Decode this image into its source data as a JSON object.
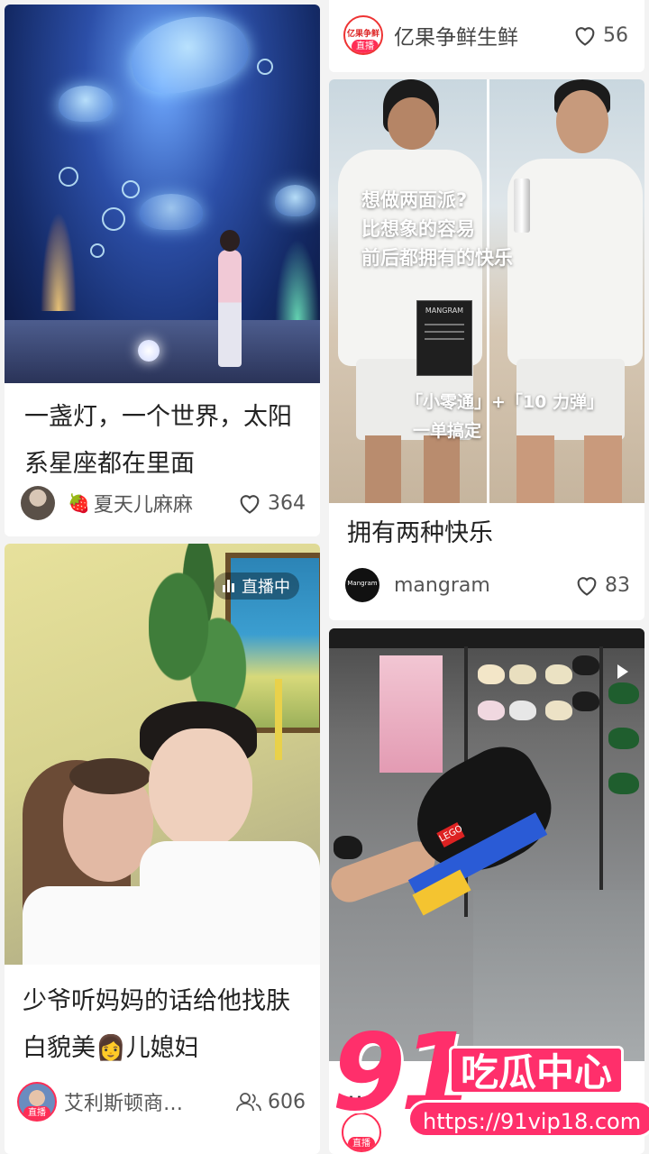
{
  "feed": {
    "cards": [
      {
        "title": "一盏灯，一个世界，太阳系星座都在里面",
        "author": "夏天儿麻麻",
        "author_emoji": "🍓",
        "likes": "364"
      },
      {
        "title": "拥有两种快乐",
        "author": "mangram",
        "avatar_text": "Mangram",
        "likes": "83",
        "overlay_lines": [
          "想做两面派?",
          "比想象的容易",
          "前后都拥有的快乐"
        ],
        "overlay_bottom_lines": [
          "「小零通」+「10 力弹」",
          "一单搞定"
        ]
      },
      {
        "title": "少爷听妈妈的话给他找肤白貌美👩儿媳妇",
        "author": "艾利斯顿商…",
        "live_chip": "直播中",
        "live_badge": "直播",
        "viewers": "606"
      },
      {
        "author": "亿果争鲜生鲜",
        "avatar_text": "亿果争鲜",
        "live_badge": "直播",
        "likes": "56"
      },
      {
        "title": "…",
        "live_badge": "直播"
      }
    ]
  },
  "watermark": {
    "logo": "91",
    "name": "吃瓜中心",
    "url": "https://91vip18.com"
  },
  "colors": {
    "accent": "#ff2f6b",
    "live": "#ff2d55",
    "text": "#222222",
    "muted": "#555555"
  }
}
